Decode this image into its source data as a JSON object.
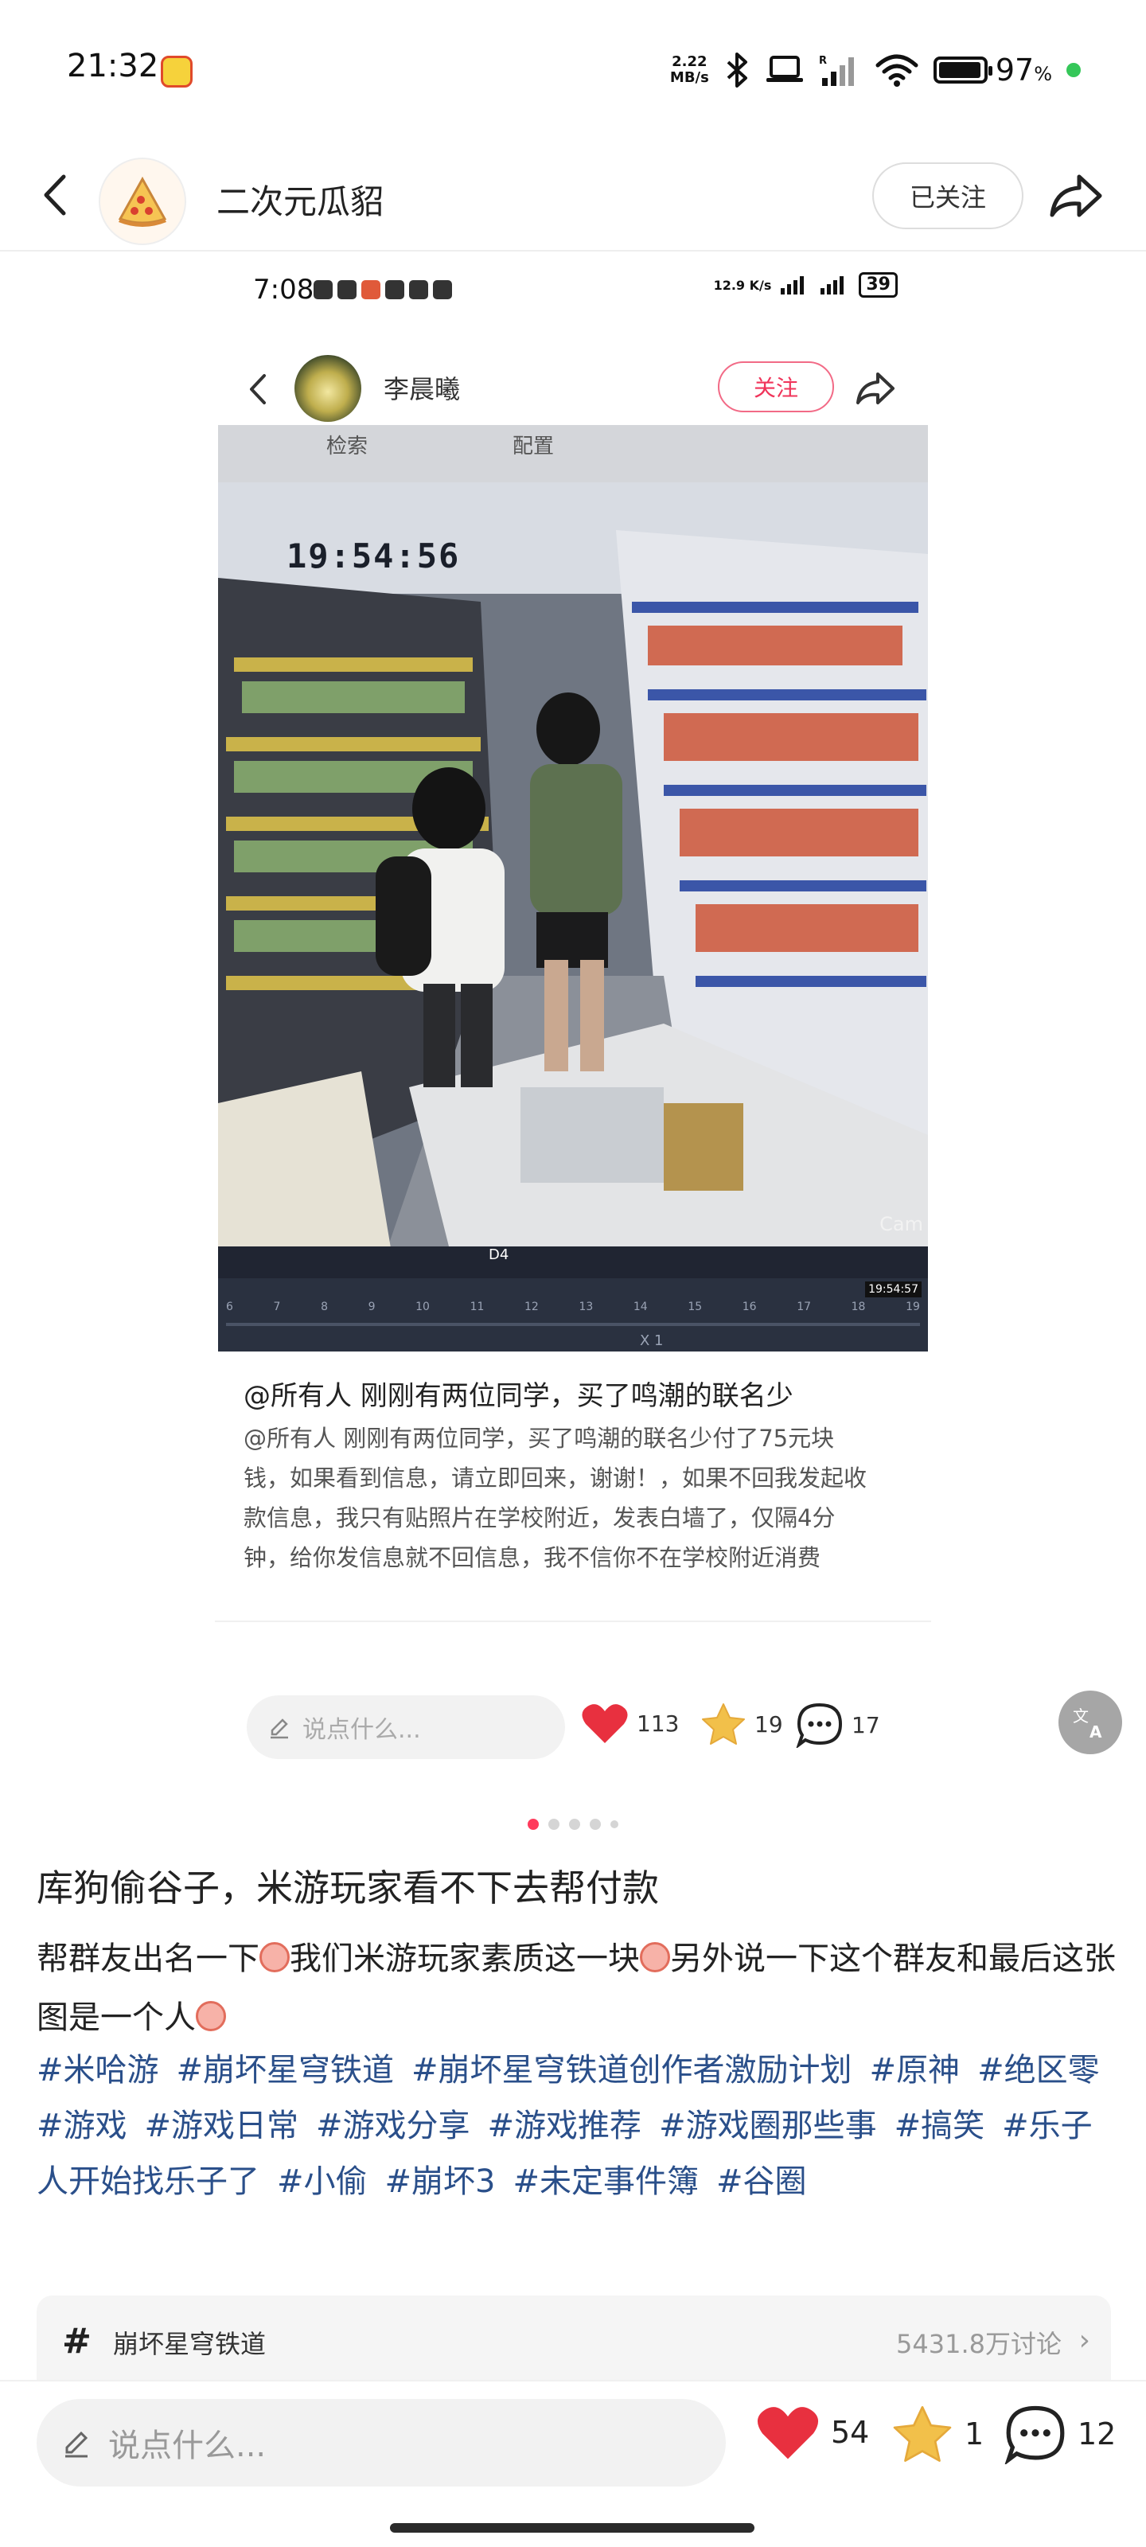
{
  "status_bar": {
    "time": "21:32",
    "net_speed_value": "2.22",
    "net_speed_unit": "MB/s",
    "battery": "97",
    "battery_unit": "%",
    "battery_level": 0.97
  },
  "nav": {
    "account_name": "二次元瓜貂",
    "follow_label": "已关注"
  },
  "embedded_screenshot": {
    "status": {
      "time": "7:08",
      "net_speed": "12.9 K/s",
      "battery": "39"
    },
    "author": "李晨曦",
    "follow_label": "关注",
    "cctv": {
      "search_label": "检索",
      "config_label": "配置",
      "timestamp": "19:54:56",
      "timeline_ticks": [
        "6",
        "7",
        "8",
        "9",
        "10",
        "11",
        "12",
        "13",
        "14",
        "15",
        "16",
        "17",
        "18",
        "19"
      ],
      "timeline_time": "19:54:57",
      "speed": "X 1",
      "channel": "D4",
      "cam_label": "Cam"
    },
    "caption_title": "@所有人 刚刚有两位同学，买了鸣潮的联名少",
    "caption_body": "@所有人 刚刚有两位同学，买了鸣潮的联名少付了75元块钱，如果看到信息，请立即回来，谢谢！，如果不回我发起收款信息，我只有贴照片在学校附近，发表白墙了，仅隔4分钟，给你发信息就不回信息，我不信你不在学校附近消费",
    "input_placeholder": "说点什么...",
    "likes": "113",
    "favorites": "19",
    "comments": "17"
  },
  "pager": {
    "total": 5,
    "active": 0
  },
  "post": {
    "title": "库狗偷谷子，米游玩家看不下去帮付款",
    "body_1": "帮群友出名一下",
    "body_2": "我们米游玩家素质这一块",
    "body_3": "另外说一下这个群友和最后这张图是一个人",
    "tags": [
      "#米哈游",
      "#崩坏星穹铁道",
      "#崩坏星穹铁道创作者激励计划",
      "#原神",
      "#绝区零",
      "#游戏",
      "#游戏日常",
      "#游戏分享",
      "#游戏推荐",
      "#游戏圈那些事",
      "#搞笑",
      "#乐子人开始找乐子了",
      "#小偷",
      "#崩坏3",
      "#未定事件簿",
      "#谷圈"
    ]
  },
  "topic": {
    "icon": "#",
    "name": "崩坏星穹铁道",
    "discussions": "5431.8万讨论"
  },
  "bottom_bar": {
    "input_placeholder": "说点什么...",
    "likes": "54",
    "favorites": "1",
    "comments": "12"
  },
  "colors": {
    "accent_red": "#f0345a",
    "like_red": "#e8303f",
    "star_gold": "#f2c04a",
    "tag_blue": "#2a4f8a"
  },
  "icons": [
    "back-icon",
    "share-icon",
    "heart-icon",
    "star-icon",
    "comment-icon",
    "pencil-icon",
    "translate-icon",
    "bluetooth-icon",
    "wifi-icon",
    "signal-icon",
    "laptop-icon"
  ]
}
